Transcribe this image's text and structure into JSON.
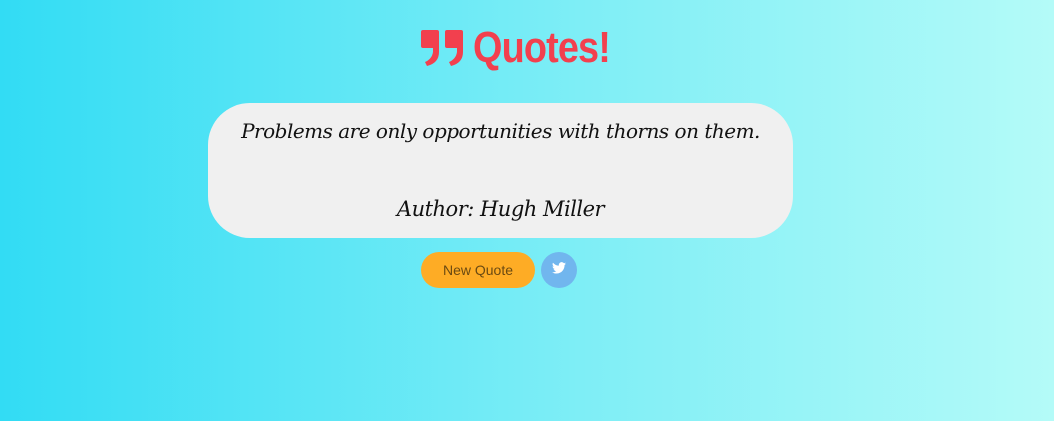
{
  "header": {
    "icon": "quote-right-icon",
    "title": "Quotes!",
    "color": "#f2404e"
  },
  "quote": {
    "text": "Problems are only opportunities with thorns on them.",
    "author": "Author: Hugh Miller"
  },
  "controls": {
    "new_quote_label": "New Quote",
    "new_quote_color": "#feac25",
    "tweet_icon": "twitter-icon",
    "tweet_color": "#71b6ee"
  },
  "background": {
    "from": "#32dcf4",
    "to": "#b4fbf8"
  }
}
